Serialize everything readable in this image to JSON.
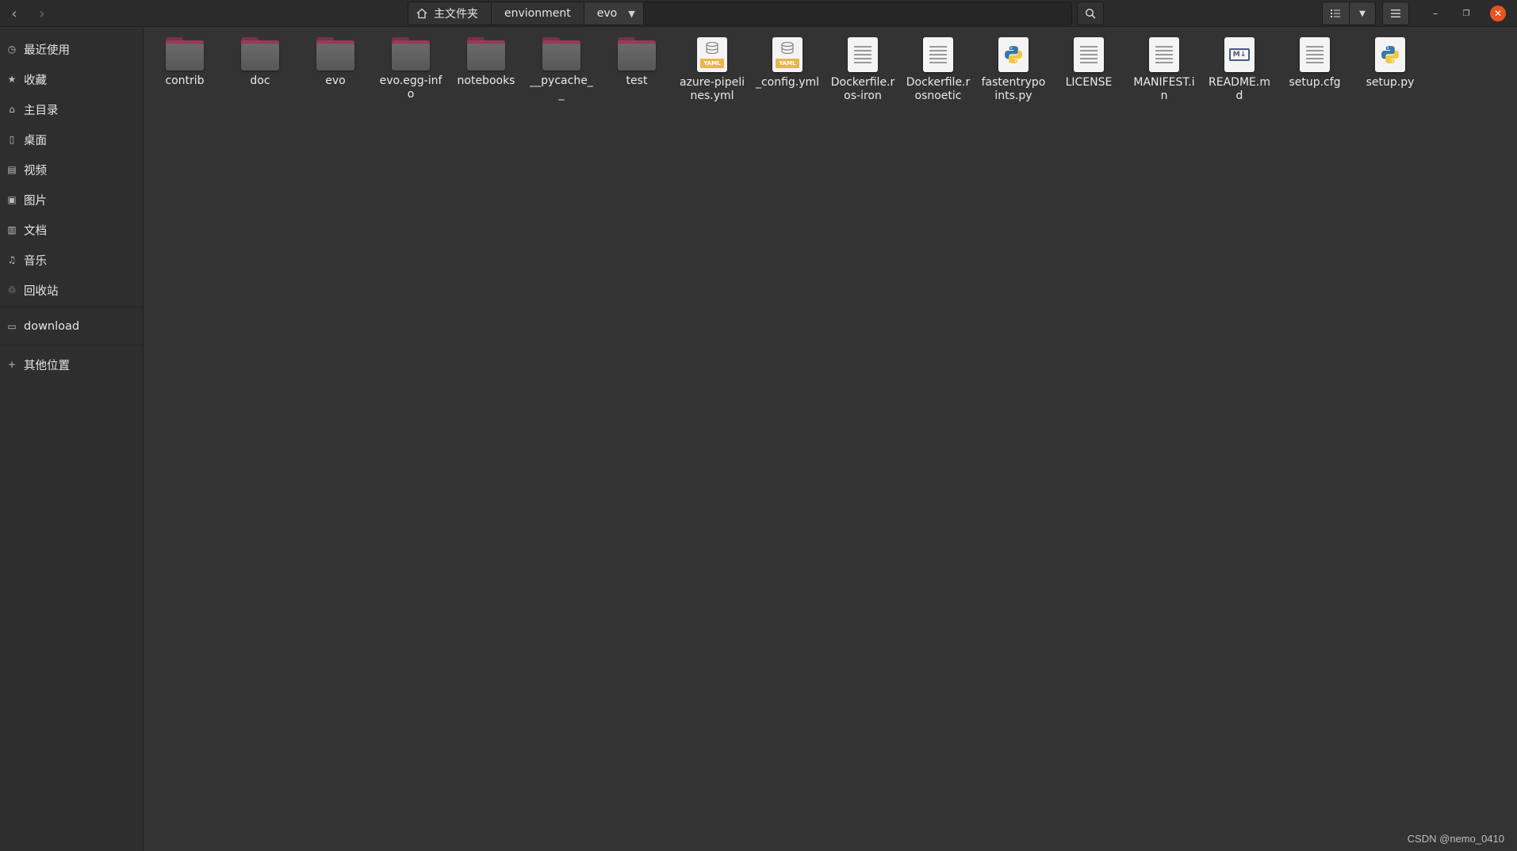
{
  "header": {
    "breadcrumbs": [
      "主文件夹",
      "envionment",
      "evo"
    ]
  },
  "sidebar": {
    "items": [
      {
        "label": "最近使用",
        "icon": "clock-icon"
      },
      {
        "label": "收藏",
        "icon": "star-icon"
      },
      {
        "label": "主目录",
        "icon": "home-icon"
      },
      {
        "label": "桌面",
        "icon": "desktop-icon"
      },
      {
        "label": "视频",
        "icon": "video-icon"
      },
      {
        "label": "图片",
        "icon": "image-icon"
      },
      {
        "label": "文档",
        "icon": "document-icon"
      },
      {
        "label": "音乐",
        "icon": "music-icon"
      },
      {
        "label": "回收站",
        "icon": "trash-icon"
      },
      {
        "label": "download",
        "icon": "folder-icon"
      },
      {
        "label": "其他位置",
        "icon": "plus-icon"
      }
    ]
  },
  "files": [
    {
      "name": "contrib",
      "type": "folder"
    },
    {
      "name": "doc",
      "type": "folder"
    },
    {
      "name": "evo",
      "type": "folder"
    },
    {
      "name": "evo.egg-info",
      "type": "folder"
    },
    {
      "name": "notebooks",
      "type": "folder"
    },
    {
      "name": "__pycache__",
      "type": "folder"
    },
    {
      "name": "test",
      "type": "folder"
    },
    {
      "name": "azure-pipelines.yml",
      "type": "yaml"
    },
    {
      "name": "_config.yml",
      "type": "yaml"
    },
    {
      "name": "Dockerfile.ros-iron",
      "type": "text"
    },
    {
      "name": "Dockerfile.rosnoetic",
      "type": "text"
    },
    {
      "name": "fastentrypoints.py",
      "type": "python"
    },
    {
      "name": "LICENSE",
      "type": "text"
    },
    {
      "name": "MANIFEST.in",
      "type": "text"
    },
    {
      "name": "README.md",
      "type": "markdown"
    },
    {
      "name": "setup.cfg",
      "type": "text"
    },
    {
      "name": "setup.py",
      "type": "python"
    }
  ],
  "icons": {
    "yaml_badge": "YAML",
    "md_badge": "M↓"
  },
  "colors": {
    "folder_accent": "#9b3a59",
    "close_button": "#e95420"
  },
  "watermark": "CSDN @nemo_0410"
}
